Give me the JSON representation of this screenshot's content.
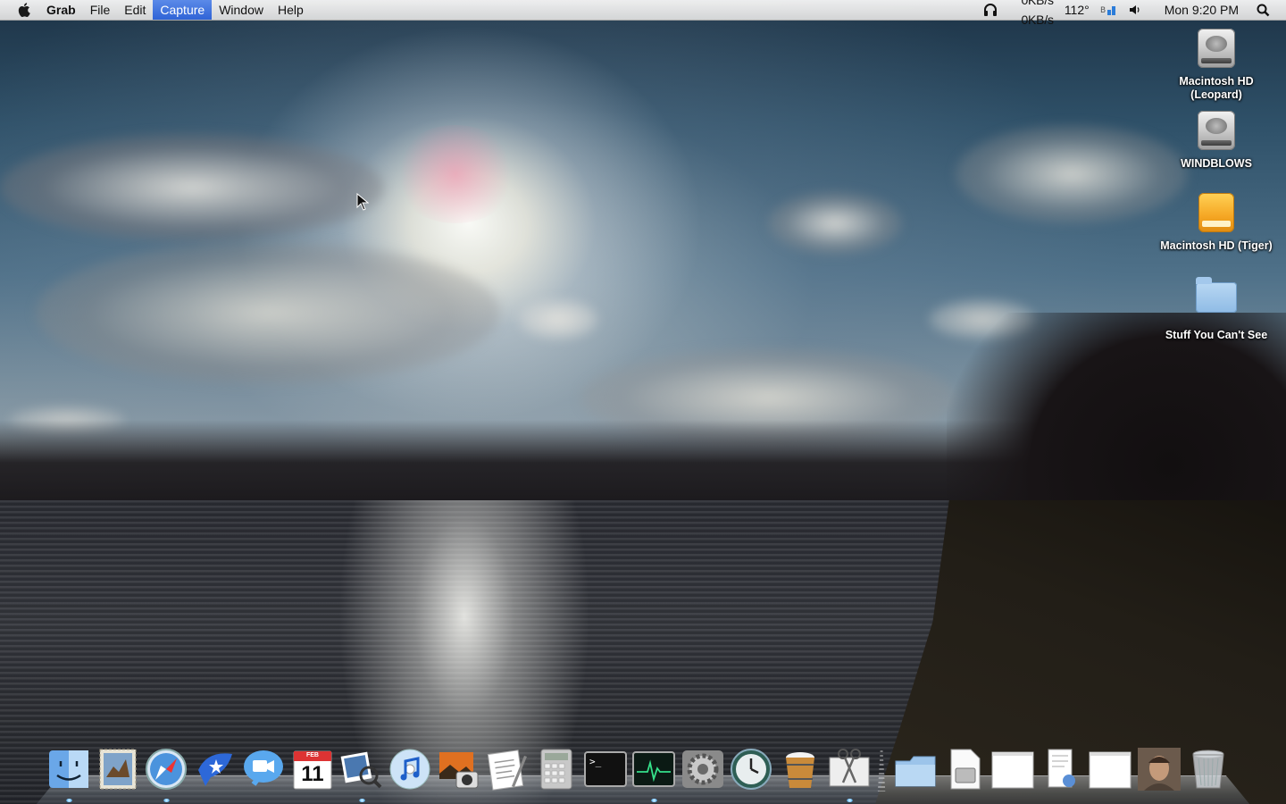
{
  "menubar": {
    "app_name": "Grab",
    "menus": [
      "File",
      "Edit",
      "Capture",
      "Window",
      "Help"
    ],
    "active_menu": "Capture",
    "status": {
      "net_up": "0KB/s",
      "net_down": "0KB/s",
      "temperature": "112°",
      "clock": "Mon 9:20 PM"
    }
  },
  "desktop_icons": [
    {
      "label": "Macintosh HD (Leopard)",
      "kind": "hard-disk"
    },
    {
      "label": "WINDBLOWS",
      "kind": "hard-disk"
    },
    {
      "label": "Macintosh HD (Tiger)",
      "kind": "firewire-disk"
    },
    {
      "label": "Stuff You Can't See",
      "kind": "folder"
    }
  ],
  "dock": {
    "apps": [
      "Finder",
      "Mail",
      "Safari",
      "iChat",
      "Video Chat",
      "iCal",
      "Preview",
      "iTunes",
      "iPhoto",
      "TextEdit",
      "Calculator",
      "Terminal",
      "Activity Monitor",
      "System Preferences",
      "Time Machine",
      "Wood Bucket",
      "Grab"
    ],
    "ical_month": "FEB",
    "ical_day": "11",
    "documents": [
      "Documents Folder",
      "Disk Image",
      "Text Document",
      "Preview Document",
      "Text Document",
      "User Photo"
    ],
    "trash_label": "Trash"
  },
  "colors": {
    "menu_highlight": "#2f63d6",
    "running_indicator": "#6ec1ff"
  }
}
